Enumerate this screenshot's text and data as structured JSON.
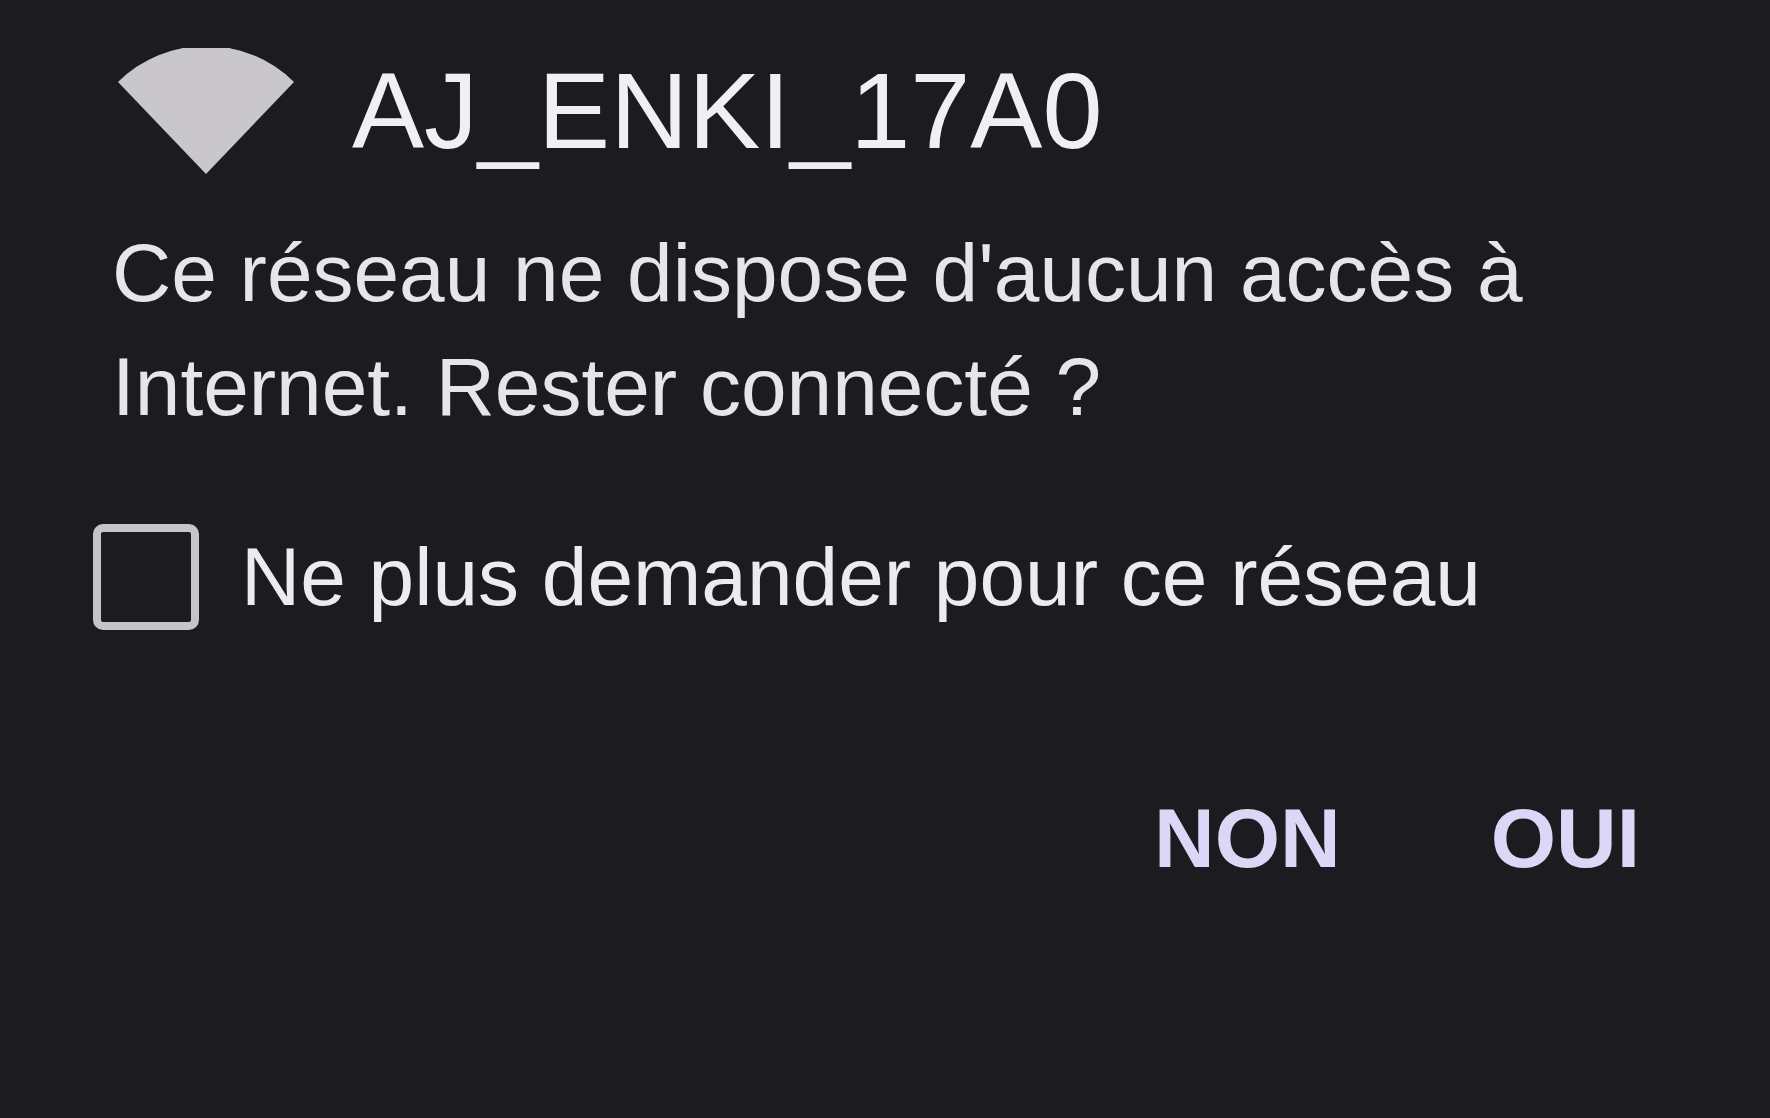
{
  "dialog": {
    "title": "AJ_ENKI_17A0",
    "message": "Ce réseau ne dispose d'aucun accès à Internet. Rester connecté ?",
    "checkbox": {
      "label": "Ne plus demander pour ce réseau",
      "checked": false
    },
    "buttons": [
      "NON",
      "OUI"
    ]
  }
}
